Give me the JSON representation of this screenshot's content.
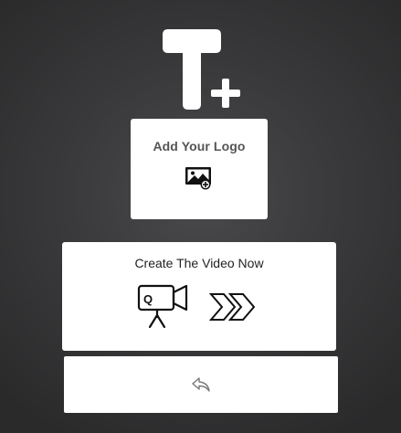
{
  "header": {
    "logo_icon": "text-plus-icon"
  },
  "logo_card": {
    "label": "Add Your Logo",
    "icon": "add-image-icon"
  },
  "video_card": {
    "label": "Create The Video Now",
    "icons": [
      "video-camera-icon",
      "double-chevron-right-icon"
    ]
  },
  "back_card": {
    "icon": "reply-arrow-icon"
  },
  "colors": {
    "background_center": "#4a4a4c",
    "background_edge": "#2a2a2b",
    "card": "#ffffff",
    "logo_label": "#555555",
    "video_label": "#222222",
    "back_icon": "#777777"
  }
}
